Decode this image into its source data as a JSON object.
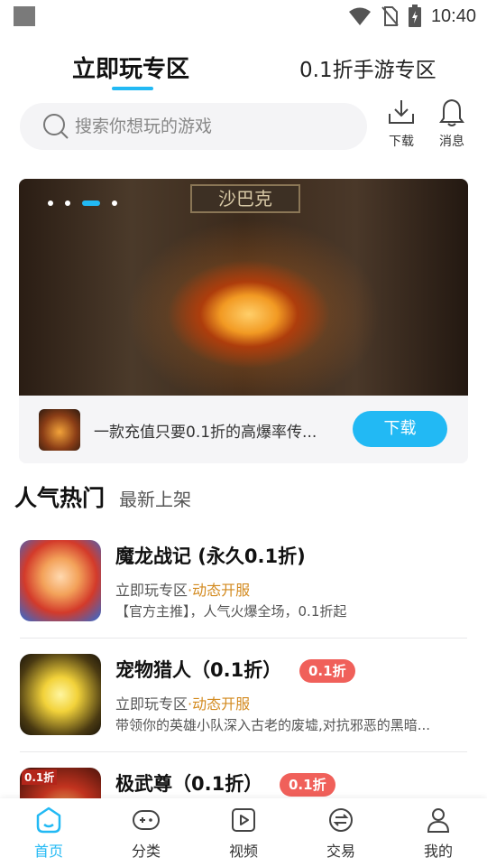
{
  "status_bar": {
    "time": "10:40",
    "icons": [
      "wifi-icon",
      "no-sim-icon",
      "battery-charging-icon"
    ]
  },
  "top_tabs": [
    {
      "label": "立即玩专区",
      "active": true
    },
    {
      "label": "0.1折手游专区",
      "active": false
    }
  ],
  "search": {
    "placeholder": "搜索你想玩的游戏",
    "icon": "search-icon"
  },
  "top_actions": {
    "download": {
      "label": "下载",
      "icon": "download-icon"
    },
    "messages": {
      "label": "消息",
      "icon": "bell-icon"
    }
  },
  "banner": {
    "sign_text": "沙巴克",
    "description": "一款充值只要0.1折的高爆率传...",
    "button_label": "下载",
    "page_count": 4,
    "active_page": 3
  },
  "section_tabs": {
    "active": "人气热门",
    "inactive": "最新上架"
  },
  "games": [
    {
      "title": "魔龙战记 (永久0.1折)",
      "badge": "",
      "source": "立即玩专区",
      "tag": "·动态开服",
      "desc": "【官方主推】，人气火爆全场，0.1折起"
    },
    {
      "title": "宠物猎人（0.1折）",
      "badge": "0.1折",
      "source": "立即玩专区",
      "tag": "·动态开服",
      "desc": "带领你的英雄小队深入古老的废墟,对抗邪恶的黑暗..."
    },
    {
      "title": "极武尊（0.1折）",
      "badge": "0.1折",
      "source": "",
      "tag": "",
      "desc": ""
    }
  ],
  "game3_icon_text": "0.1折",
  "bottom_nav": [
    {
      "label": "首页",
      "icon": "home-icon",
      "active": true
    },
    {
      "label": "分类",
      "icon": "gamepad-icon",
      "active": false
    },
    {
      "label": "视频",
      "icon": "video-icon",
      "active": false
    },
    {
      "label": "交易",
      "icon": "exchange-icon",
      "active": false
    },
    {
      "label": "我的",
      "icon": "user-icon",
      "active": false
    }
  ],
  "colors": {
    "accent": "#22b9f4",
    "badge": "#f0605a",
    "highlight": "#d38a1f"
  }
}
